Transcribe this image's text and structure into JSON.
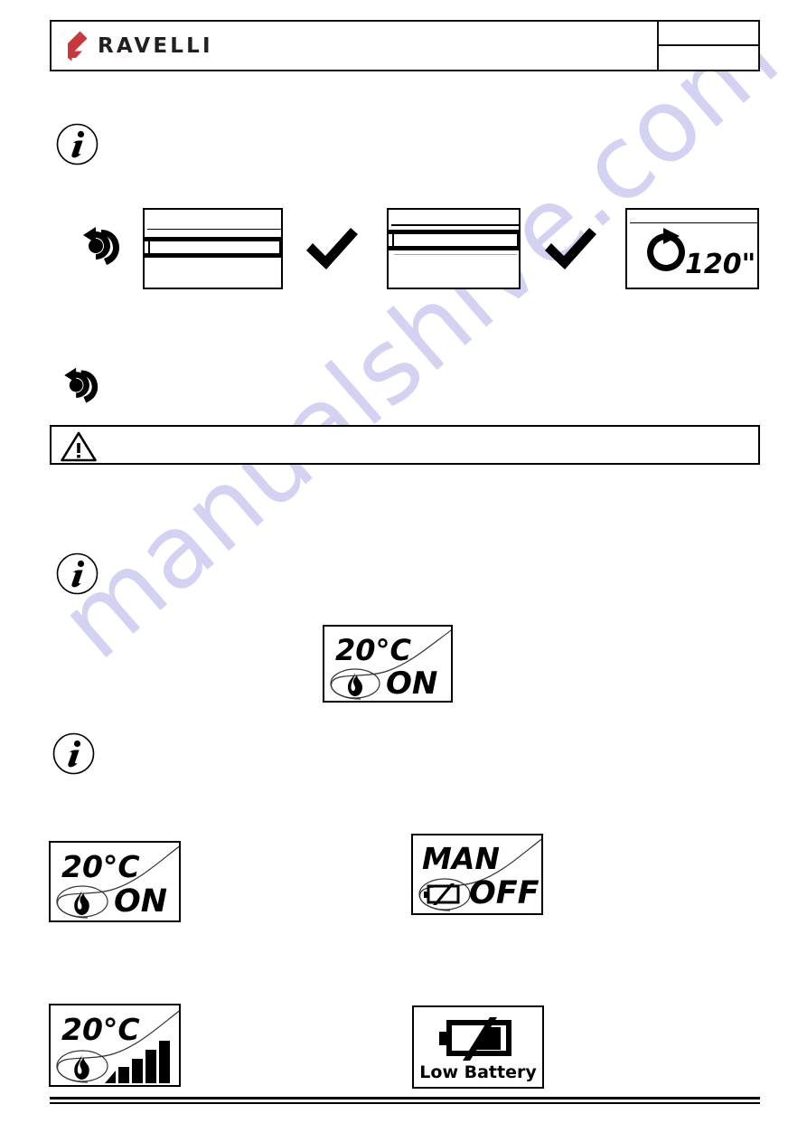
{
  "header": {
    "brand_name": "RAVELLI",
    "brand_color": "#c8373c",
    "logo_icon": "ravelli-flame-logo",
    "cell_top_text": "",
    "cell_bottom_text": ""
  },
  "watermark": {
    "text": "manualshive.com",
    "color": "#d3d2f2"
  },
  "notes": {
    "info_icon_1": "info-icon",
    "info_icon_2": "info-icon",
    "info_icon_3": "info-icon",
    "knob_icon_1": "knob-rotate-icon",
    "knob_icon_2": "knob-rotate-icon",
    "warning_icon": "warning-triangle-icon",
    "check_icon_1": "checkmark-icon",
    "check_icon_2": "checkmark-icon"
  },
  "sequence_row": {
    "panel_1": {
      "name": "display-blank-1",
      "text": ""
    },
    "panel_2": {
      "name": "display-blank-2",
      "text": ""
    },
    "panel_3": {
      "name": "display-timer",
      "timer_value": "120\"",
      "icon": "circular-arrow-icon"
    }
  },
  "displays": {
    "center_on": {
      "name": "display-temp-on",
      "temperature": "20°C",
      "status": "ON",
      "icon": "flame-icon"
    },
    "left_on": {
      "name": "display-temp-on-2",
      "temperature": "20°C",
      "status": "ON",
      "icon": "flame-icon"
    },
    "right_man_off": {
      "name": "display-man-off",
      "mode": "MAN",
      "status": "OFF",
      "icon": "battery-empty-icon"
    },
    "left_power": {
      "name": "display-temp-power",
      "temperature": "20°C",
      "icon": "flame-icon",
      "power_bars": 5
    },
    "right_low_battery": {
      "name": "display-low-battery",
      "label": "Low Battery",
      "icon": "battery-low-icon"
    }
  }
}
